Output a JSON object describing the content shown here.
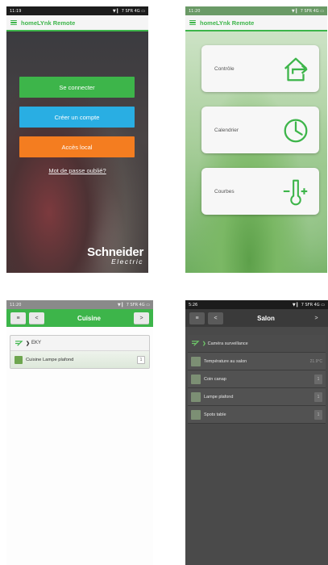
{
  "colors": {
    "brand_green": "#3db54a",
    "blue": "#29aee3",
    "orange": "#f47d20",
    "dark_nav": "#3a3a3a"
  },
  "screen1": {
    "status": {
      "time": "11:19",
      "right": "▼ ▎ 7 SFR 4G ▭"
    },
    "app_title": "homeLYnk Remote",
    "connect_button": "Se connecter",
    "create_account_button": "Créer un compte",
    "local_access_button": "Accès local",
    "forgot_password_link": "Mot de passe oublié?",
    "logo_main": "Schneider",
    "logo_sub": "Electric"
  },
  "screen2": {
    "status": {
      "time": "11:20",
      "right": "▼ ▎ 7 SFR 4G ▭"
    },
    "app_title": "homeLYnk Remote",
    "tiles": [
      {
        "label": "Contrôle",
        "icon": "arrow-house-icon"
      },
      {
        "label": "Calendrier",
        "icon": "clock-icon"
      },
      {
        "label": "Courbes",
        "icon": "thermometer-icon"
      }
    ]
  },
  "screen3": {
    "status": {
      "time": "11:20",
      "right": "▼ ▎ 7 SFR 4G ▭"
    },
    "menu_button": "≡",
    "back_button": "<",
    "title": "Cuisine",
    "next_button": ">",
    "group_label": "EKY",
    "row_label": "Cuisine Lampe plafond",
    "row_value": "1"
  },
  "screen4": {
    "status": {
      "time": "5:26",
      "right": "▼ ▎ 7 SFR 4G ▭"
    },
    "menu_button": "≡",
    "back_button": "<",
    "title": "Salon",
    "next_button": ">",
    "header_row": "Caméra surveillance",
    "rows": [
      {
        "label": "Température au salon",
        "value": "21.9°C"
      },
      {
        "label": "Coin canap",
        "value": "1"
      },
      {
        "label": "Lampe plafond",
        "value": "1"
      },
      {
        "label": "Spots table",
        "value": "1"
      }
    ]
  }
}
